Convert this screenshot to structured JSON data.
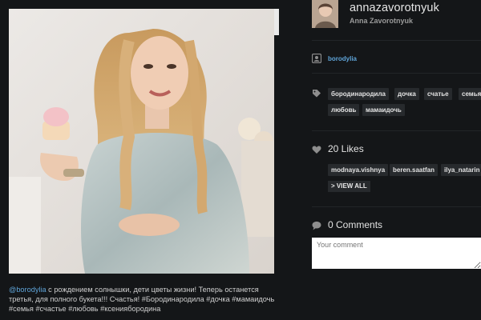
{
  "post": {
    "caption_mention": "@borodylia",
    "caption_text": " с рождением солнышки, дети цветы жизни! Теперь останется третья, для полного букета!!! Счастья! #Бородинародила #дочка #мамаидочь #семья #счастье #любовь #ксениябородина"
  },
  "author": {
    "username": "annazavorotnyuk",
    "full_name": "Anna Zavorotnyuk"
  },
  "tagged": {
    "icon": "person-tag-icon",
    "user": "borodylia"
  },
  "tags": {
    "icon": "tag-icon",
    "items": [
      "бородинародила",
      "дочка",
      "счатье",
      "семья",
      "любовь",
      "мамаидочь"
    ]
  },
  "likes": {
    "icon": "heart-icon",
    "label": "20 Likes",
    "users": [
      "modnaya.vishnya",
      "beren.saatfan",
      "ilya_natarin"
    ],
    "view_all": "> VIEW ALL"
  },
  "comments": {
    "icon": "speech-bubble-icon",
    "label": "0 Comments",
    "placeholder": "Your comment"
  },
  "colors": {
    "background": "#141618",
    "chip": "#272a2d",
    "link": "#5fa4d8"
  }
}
